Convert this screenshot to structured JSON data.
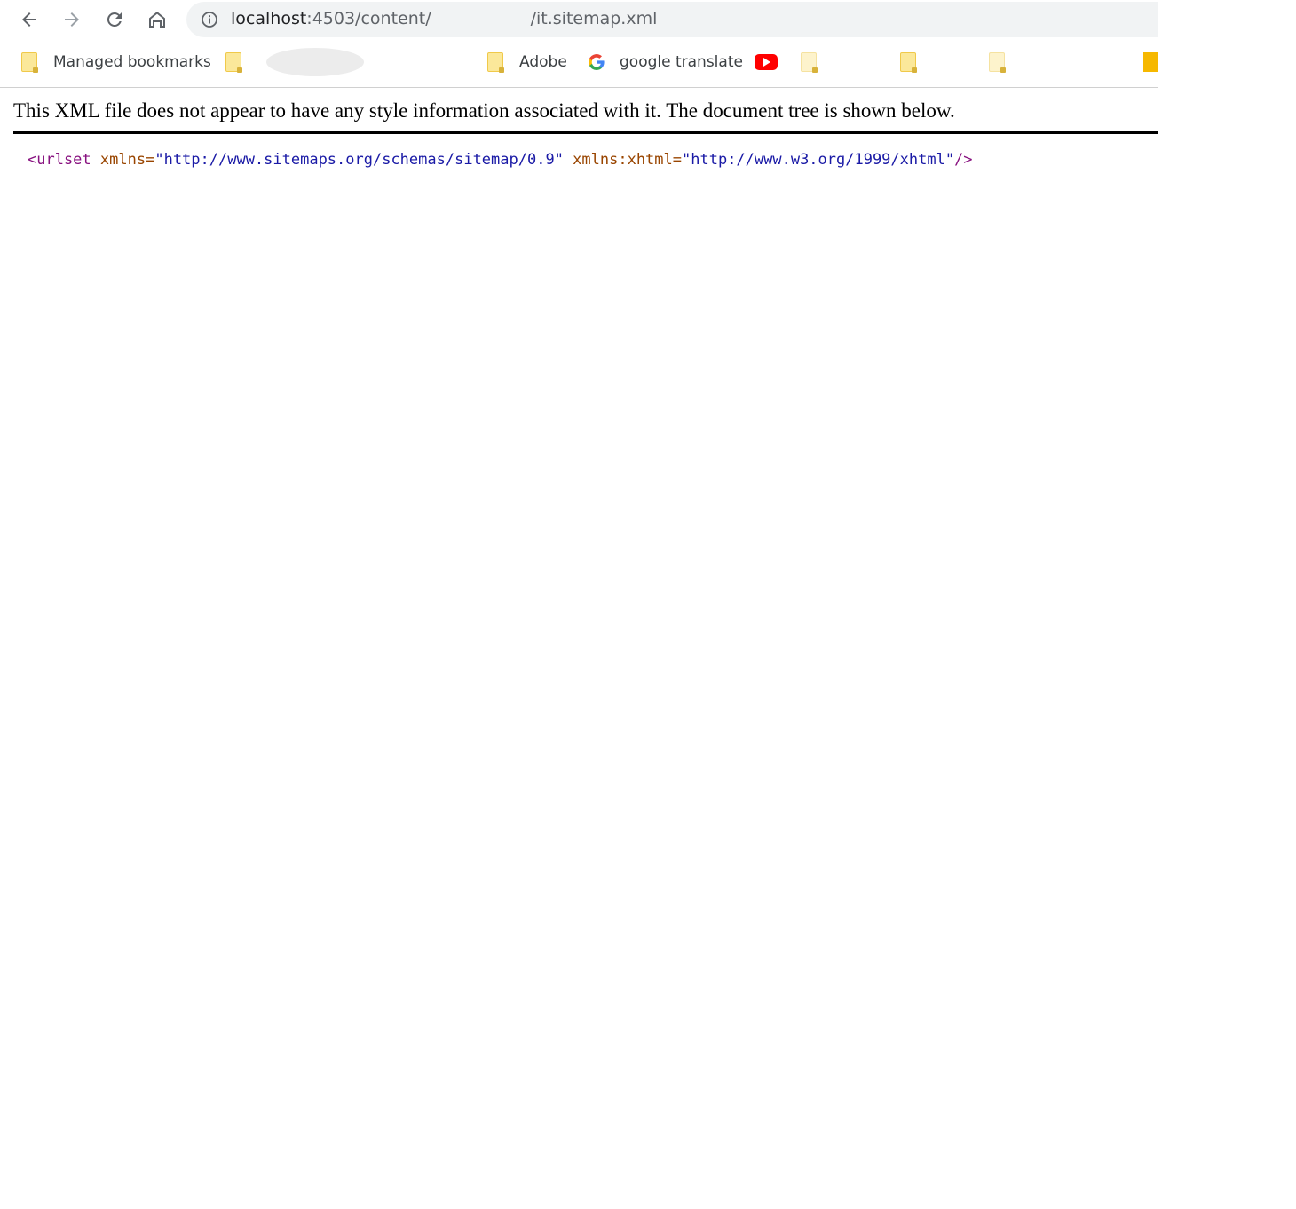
{
  "browser": {
    "url_host": "localhost",
    "url_path_start": ":4503/content/",
    "url_path_end": "/it.sitemap.xml"
  },
  "bookmarks": {
    "managed": "Managed bookmarks",
    "adobe": "Adobe",
    "google_translate": "google translate"
  },
  "xml_viewer": {
    "notice": "This XML file does not appear to have any style information associated with it. The document tree is shown below.",
    "root_tag_open": "<urlset",
    "attr1_name": "xmlns",
    "attr1_value": "\"http://www.sitemaps.org/schemas/sitemap/0.9\"",
    "attr2_name": "xmlns:xhtml",
    "attr2_value": "\"http://www.w3.org/1999/xhtml\"",
    "root_tag_close": "/>"
  },
  "colors": {
    "tag": "#881280",
    "attr": "#994500",
    "value": "#1a1aa6"
  }
}
